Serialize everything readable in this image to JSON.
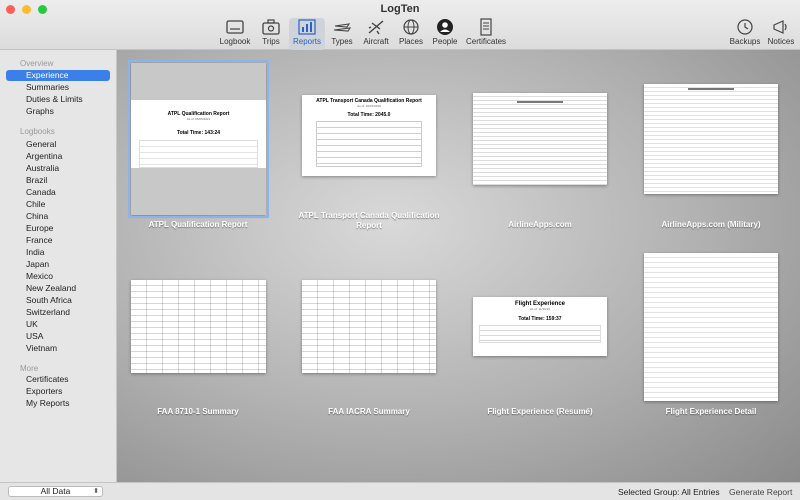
{
  "window": {
    "title": "LogTen"
  },
  "toolbar": {
    "logbook": "Logbook",
    "trips": "Trips",
    "reports": "Reports",
    "types": "Types",
    "aircraft": "Aircraft",
    "places": "Places",
    "people": "People",
    "certificates": "Certificates",
    "backups": "Backups",
    "notices": "Notices"
  },
  "sidebar": {
    "overview_header": "Overview",
    "overview": [
      "Experience",
      "Summaries",
      "Duties & Limits",
      "Graphs"
    ],
    "logbooks_header": "Logbooks",
    "logbooks": [
      "General",
      "Argentina",
      "Australia",
      "Brazil",
      "Canada",
      "Chile",
      "China",
      "Europe",
      "France",
      "India",
      "Japan",
      "Mexico",
      "New Zealand",
      "South Africa",
      "Switzerland",
      "UK",
      "USA",
      "Vietnam"
    ],
    "more_header": "More",
    "more": [
      "Certificates",
      "Exporters",
      "My Reports"
    ]
  },
  "reports": [
    {
      "title": "ATPL Qualification Report",
      "doc_title": "ATPL Qualification Report",
      "doc_sub": "As of: 05/05/2021",
      "doc_total": "Total Time: 143:24"
    },
    {
      "title": "ATPL Transport Canada Qualification Report",
      "doc_title": "ATPL Transport Canada Qualification Report",
      "doc_sub": "As of: 10/07/2019",
      "doc_total": "Total Time: 2045.0"
    },
    {
      "title": "AirlineApps.com"
    },
    {
      "title": "AirlineApps.com (Military)"
    },
    {
      "title": "FAA 8710-1 Summary"
    },
    {
      "title": "FAA IACRA Summary"
    },
    {
      "title": "Flight Experience (Resumé)",
      "doc_title": "Flight Experience",
      "doc_sub": "As of: 11/10/19",
      "doc_total": "Total Time: 159:37"
    },
    {
      "title": "Flight Experience Detail"
    }
  ],
  "bottom": {
    "filter": "All Data",
    "status": "Selected Group: All Entries",
    "generate": "Generate Report"
  },
  "colors": {
    "accent": "#3b80e8",
    "close": "#fe5f57",
    "min": "#febc2e",
    "max": "#28c840"
  }
}
